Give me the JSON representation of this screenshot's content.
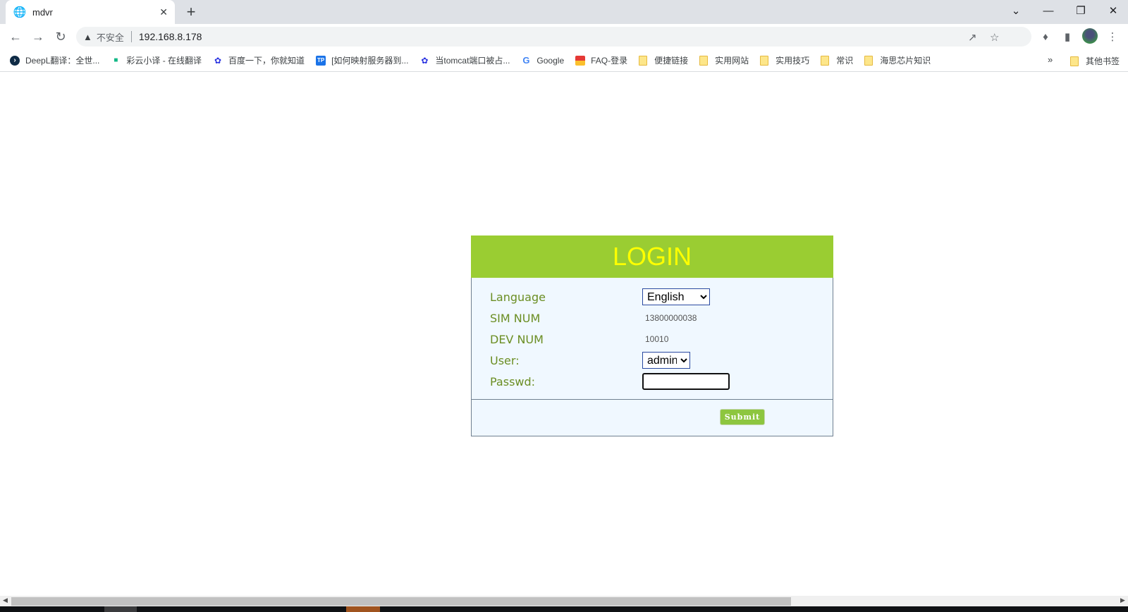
{
  "browser": {
    "tab_title": "mdvr",
    "tab_favicon": "globe-icon",
    "security_label": "不安全",
    "url": "192.168.8.178",
    "bookmarks": [
      {
        "label": "DeepL翻译：全世...",
        "icon": "deepl-icon",
        "color": "#0f2b46"
      },
      {
        "label": "彩云小译 - 在线翻译",
        "icon": "caiyun-icon",
        "color": "#12b886"
      },
      {
        "label": "百度一下，你就知道",
        "icon": "baidu-icon",
        "color": "#2932e1"
      },
      {
        "label": "[如何映射服务器到...",
        "icon": "tp-icon",
        "color": "#1a73e8"
      },
      {
        "label": "当tomcat端口被占...",
        "icon": "baidu-icon",
        "color": "#2932e1"
      },
      {
        "label": "Google",
        "icon": "google-icon",
        "color": "#4285f4"
      },
      {
        "label": "FAQ-登录",
        "icon": "faq-icon",
        "color": "#e53935"
      },
      {
        "label": "便捷链接",
        "icon": "folder-icon"
      },
      {
        "label": "实用网站",
        "icon": "folder-icon"
      },
      {
        "label": "实用技巧",
        "icon": "folder-icon"
      },
      {
        "label": "常识",
        "icon": "folder-icon"
      },
      {
        "label": "海思芯片知识",
        "icon": "folder-icon"
      }
    ],
    "more_bookmarks": "»",
    "other_bookmarks": "其他书签"
  },
  "login": {
    "title": "LOGIN",
    "language_label": "Language",
    "language_value": "English",
    "sim_label": "SIM NUM",
    "sim_value": "13800000038",
    "dev_label": "DEV NUM",
    "dev_value": "10010",
    "user_label": "User:",
    "user_value": "admin",
    "passwd_label": "Passwd:",
    "passwd_value": "",
    "submit_label": "Submit"
  },
  "colors": {
    "header_bg": "#9acd32",
    "title_color": "#ffff00",
    "body_bg": "#f0f8ff",
    "label_color": "#6b8e23",
    "submit_bg": "#8dc63f"
  }
}
